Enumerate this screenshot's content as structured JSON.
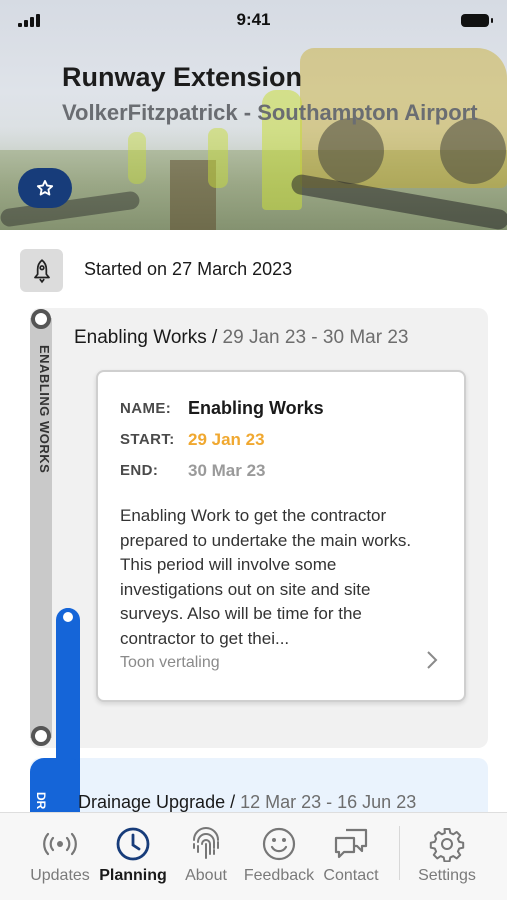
{
  "status_bar": {
    "time": "9:41"
  },
  "project": {
    "title": "Runway Extension",
    "subtitle": "VolkerFitzpatrick - Southampton Airport"
  },
  "started": {
    "text": "Started on 27 March 2023"
  },
  "phases": [
    {
      "vertical_label": "ENABLING WORKS",
      "name": "Enabling Works /",
      "dates": " 29 Jan 23 - 30 Mar 23",
      "card": {
        "name_label": "NAME:",
        "name_value": "Enabling Works",
        "start_label": "START:",
        "start_value": "29 Jan 23",
        "end_label": "END:",
        "end_value": "30 Mar 23",
        "description": "Enabling Work to get the contractor prepared to undertake the main works. This period will involve some investigations out on site and site surveys. Also will be time for the contractor to get thei...",
        "translate_link": "Toon vertaling"
      }
    },
    {
      "vertical_label": "DR",
      "name": "Drainage Upgrade /",
      "dates": " 12 Mar 23 - 16 Jun 23"
    }
  ],
  "tabs": [
    {
      "label": "Updates",
      "icon": "broadcast-icon"
    },
    {
      "label": "Planning",
      "icon": "clock-icon"
    },
    {
      "label": "About",
      "icon": "fingerprint-icon"
    },
    {
      "label": "Feedback",
      "icon": "smiley-icon"
    },
    {
      "label": "Contact",
      "icon": "chat-bubbles-icon"
    },
    {
      "label": "Settings",
      "icon": "gear-icon"
    }
  ],
  "colors": {
    "primary_navy": "#173c7a",
    "timeline_blue": "#1565d8",
    "start_orange": "#f0a830"
  }
}
